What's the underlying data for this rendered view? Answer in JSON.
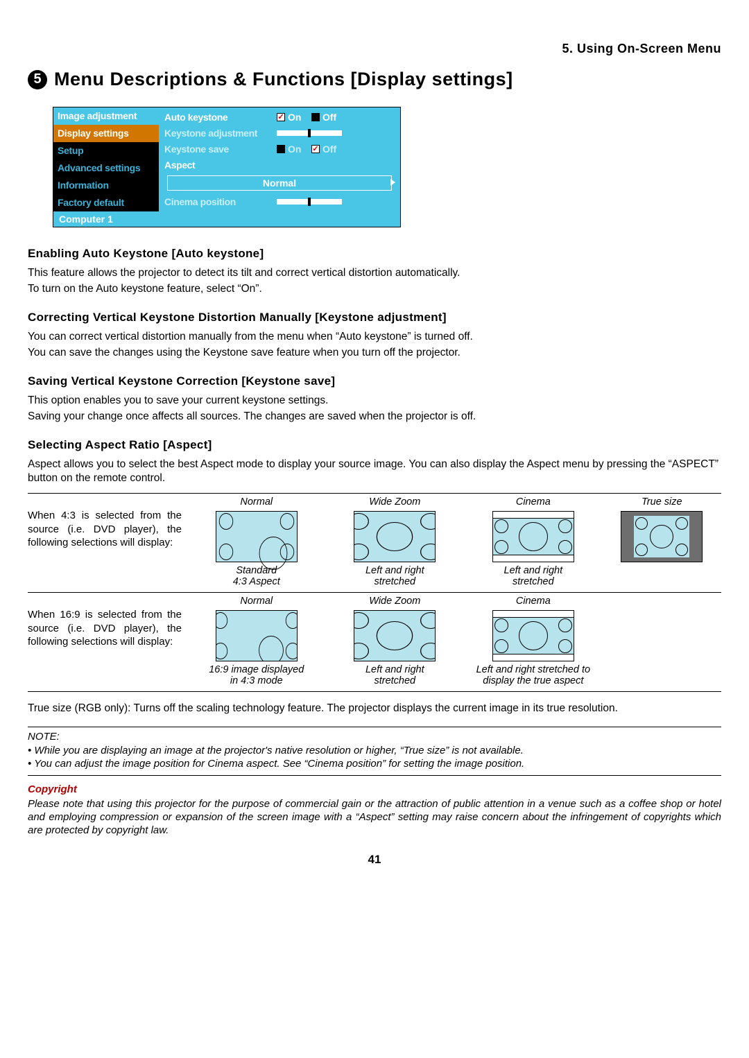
{
  "chapter": "5. Using On-Screen Menu",
  "title_number": "5",
  "title": "Menu Descriptions & Functions [Display settings]",
  "osd": {
    "left_items": [
      "Image adjustment",
      "Display settings",
      "Setup",
      "Advanced settings",
      "Information",
      "Factory default"
    ],
    "active_index": 1,
    "right": {
      "autokeystone_label": "Auto keystone",
      "on": "On",
      "off": "Off",
      "keystone_adj_label": "Keystone adjustment",
      "keystone_save_label": "Keystone save",
      "aspect_label": "Aspect",
      "aspect_value": "Normal",
      "cinema_pos_label": "Cinema position"
    },
    "footer": "Computer 1"
  },
  "sections": {
    "s1_h": "Enabling Auto Keystone [Auto keystone]",
    "s1_p1": "This feature allows the projector to detect its tilt and correct vertical distortion automatically.",
    "s1_p2": "To turn on the Auto keystone feature, select “On”.",
    "s2_h": "Correcting Vertical Keystone Distortion Manually [Keystone adjustment]",
    "s2_p1": "You can correct vertical distortion manually from the menu when “Auto keystone” is turned off.",
    "s2_p2": "You can save the changes using the Keystone save feature when you turn off the projector.",
    "s3_h": "Saving Vertical Keystone Correction [Keystone save]",
    "s3_p1": "This option enables you to save your current keystone settings.",
    "s3_p2": "Saving your change once affects all sources. The changes are saved when the projector is off.",
    "s4_h": "Selecting Aspect Ratio [Aspect]",
    "s4_p": "Aspect allows you to select the best Aspect mode to display your source image. You can also display the Aspect menu by pressing the “ASPECT” button on the remote control.",
    "truesize": "True size (RGB only): Turns off the scaling technology feature. The projector displays the current image in its true resolution."
  },
  "aspect_table": {
    "d43": "When 4:3 is selected from the source (i.e. DVD player), the following selections will display:",
    "d169": "When 16:9 is selected from the source (i.e. DVD player), the following selections will display:",
    "h_normal": "Normal",
    "h_wide": "Wide Zoom",
    "h_cinema": "Cinema",
    "h_true": "True size",
    "sub43_normal": "Standard\n4:3 Aspect",
    "sub43_wide": "Left and right\nstretched",
    "sub43_cinema": "Left and right\nstretched",
    "sub169_normal": "16:9 image displayed\nin 4:3 mode",
    "sub169_wide": "Left and right\nstretched",
    "sub169_cinema": "Left and right stretched to\ndisplay the true aspect"
  },
  "note": {
    "label": "NOTE:",
    "n1": "•  While you are displaying an image at the projector's native resolution or higher, “True size” is not available.",
    "n2": "•  You can adjust the image position for Cinema aspect. See “Cinema position” for setting the image position."
  },
  "copyright": {
    "h": "Copyright",
    "body": "Please note that using this projector for the purpose of commercial gain or the attraction of public attention in a venue such as a coffee shop or hotel and employing compression or expansion of the screen image with a “Aspect” setting may raise concern about the infringement of copyrights which are protected by copyright law."
  },
  "page": "41"
}
